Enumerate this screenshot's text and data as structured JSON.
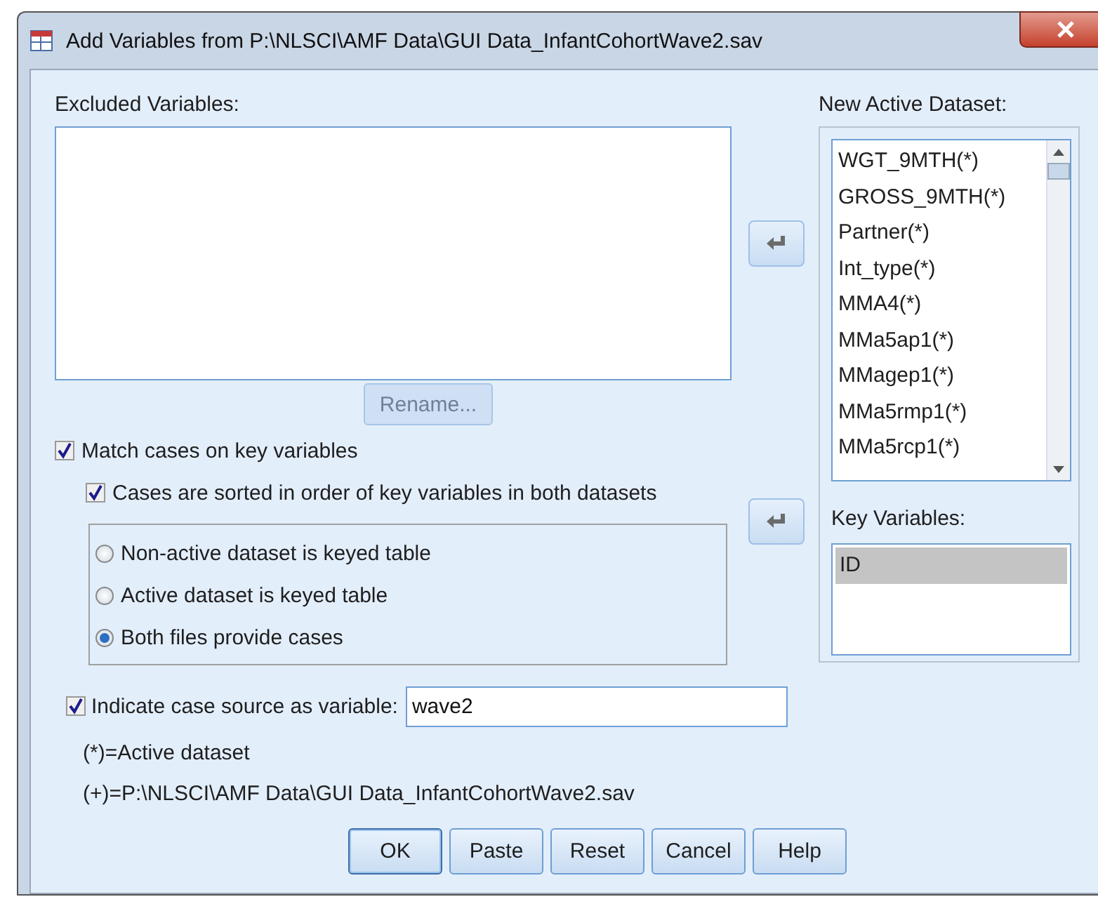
{
  "window": {
    "title": "Add Variables from P:\\NLSCI\\AMF Data\\GUI Data_InfantCohortWave2.sav"
  },
  "excluded": {
    "label": "Excluded Variables:",
    "rename_button": {
      "label": "Rename...",
      "disabled": true
    }
  },
  "active_dataset": {
    "label": "New Active Dataset:",
    "items": [
      "WGT_9MTH(*)",
      "GROSS_9MTH(*)",
      "Partner(*)",
      "Int_type(*)",
      "MMA4(*)",
      "MMa5ap1(*)",
      "MMagep1(*)",
      "MMa5rmp1(*)",
      "MMa5rcp1(*)"
    ]
  },
  "match_cases": {
    "label": "Match cases on key variables",
    "checked": true
  },
  "sorted": {
    "label": "Cases are sorted in order of key variables in both datasets",
    "checked": true
  },
  "radios": [
    {
      "label": "Non-active dataset is keyed table",
      "selected": false
    },
    {
      "label": "Active dataset is keyed table",
      "selected": false
    },
    {
      "label": "Both files provide cases",
      "selected": true
    }
  ],
  "key_variables": {
    "label": "Key Variables:",
    "items": [
      {
        "label": "ID",
        "selected": true
      }
    ]
  },
  "case_source": {
    "label": "Indicate case source as variable:",
    "checked": true,
    "value": "wave2"
  },
  "notes": [
    "(*)=Active dataset",
    "(+)=P:\\NLSCI\\AMF Data\\GUI Data_InfantCohortWave2.sav"
  ],
  "buttons": [
    {
      "label": "OK",
      "default": true
    },
    {
      "label": "Paste",
      "default": false
    },
    {
      "label": "Reset",
      "default": false
    },
    {
      "label": "Cancel",
      "default": false
    },
    {
      "label": "Help",
      "default": false
    }
  ]
}
